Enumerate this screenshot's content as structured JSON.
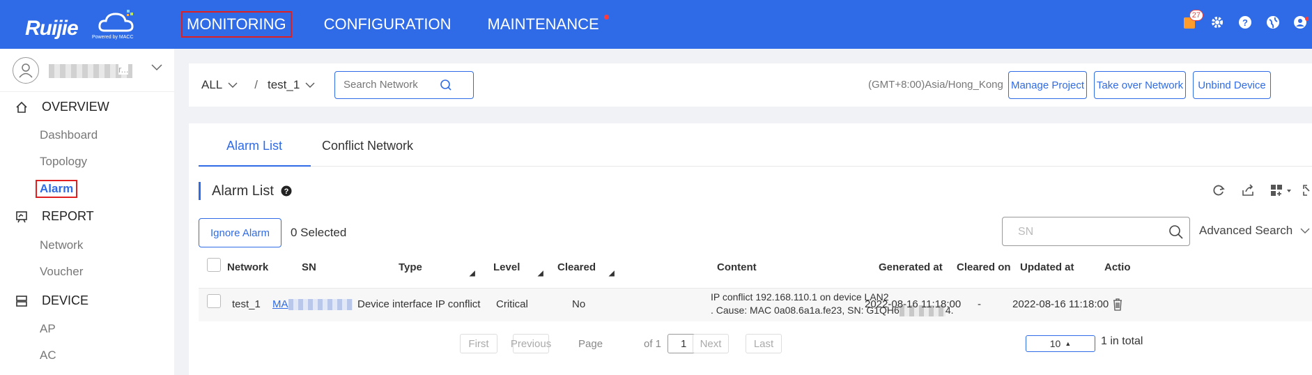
{
  "brand": {
    "name": "Ruijie",
    "powered_by": "Powered by MACC"
  },
  "topnav": {
    "items": [
      {
        "label": "MONITORING",
        "active": true
      },
      {
        "label": "CONFIGURATION"
      },
      {
        "label": "MAINTENANCE",
        "has_dot": true
      }
    ],
    "notification_count": "27",
    "icons": [
      "notification-icon",
      "gear-icon",
      "help-icon",
      "globe-icon",
      "user-icon"
    ]
  },
  "sidebar": {
    "user_suffix": "r...",
    "groups": [
      {
        "label": "OVERVIEW",
        "icon": "home-icon",
        "items": [
          "Dashboard",
          "Topology",
          "Alarm"
        ],
        "active_item": "Alarm"
      },
      {
        "label": "REPORT",
        "icon": "report-icon",
        "items": [
          "Network",
          "Voucher"
        ]
      },
      {
        "label": "DEVICE",
        "icon": "device-icon",
        "items": [
          "AP",
          "AC"
        ]
      }
    ]
  },
  "header": {
    "scope": "ALL",
    "project": "test_1",
    "search_placeholder": "Search Network",
    "timezone": "(GMT+8:00)Asia/Hong_Kong",
    "buttons": [
      "Manage Project",
      "Take over Network",
      "Unbind Device"
    ]
  },
  "tabs": [
    "Alarm List",
    "Conflict Network"
  ],
  "section": {
    "title": "Alarm List"
  },
  "toolbar": {
    "ignore_label": "Ignore Alarm",
    "selected_label": "0 Selected",
    "sn_placeholder": "SN",
    "advanced_search": "Advanced Search"
  },
  "table": {
    "columns": [
      "Network",
      "SN",
      "Type",
      "Level",
      "Cleared",
      "Content",
      "Generated at",
      "Cleared on",
      "Updated at",
      "Actio"
    ],
    "rows": [
      {
        "network": "test_1",
        "sn_prefix": "MA",
        "type": "Device interface IP conflict",
        "level": "Critical",
        "cleared": "No",
        "content_line1": "IP conflict 192.168.110.1 on device LAN2",
        "content_line2_a": ". Cause: MAC 0a08.6a1a.fe23, SN: G1QH6",
        "content_line2_b": "4.",
        "generated_at": "2022-08-16 11:18:00",
        "cleared_on": "-",
        "updated_at": "2022-08-16 11:18:00"
      }
    ]
  },
  "pagination": {
    "first": "First",
    "previous": "Previous",
    "page_label": "Page",
    "page_value": "1",
    "of_label": "of 1",
    "next": "Next",
    "last": "Last",
    "page_size": "10",
    "total": "1 in total"
  },
  "colors": {
    "primary": "#2f6be6",
    "highlight_border": "#e02020"
  }
}
